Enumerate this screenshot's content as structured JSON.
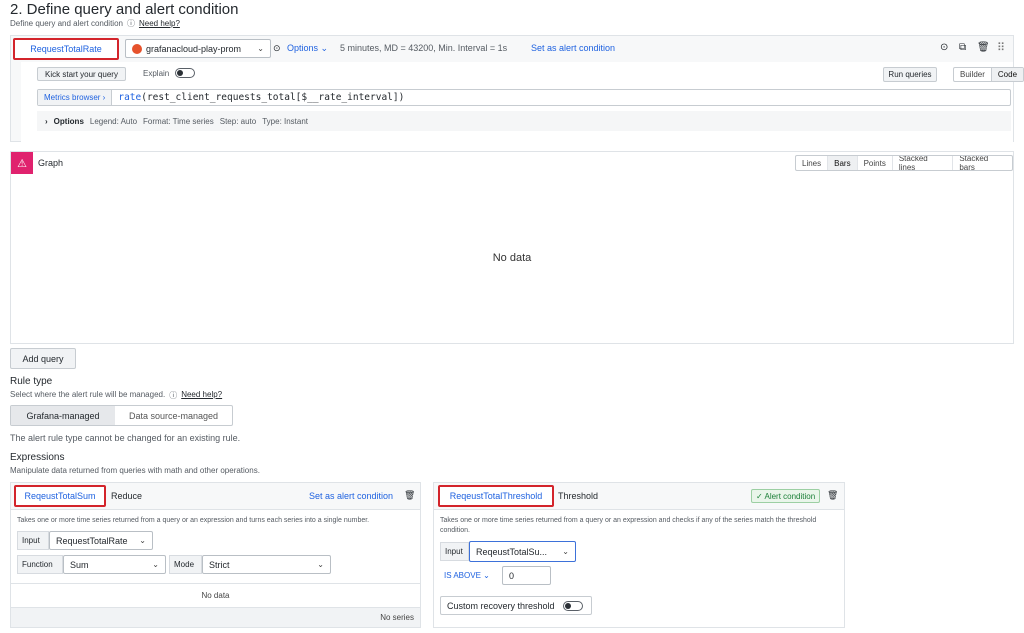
{
  "header": {
    "title": "2. Define query and alert condition",
    "subtitle": "Define query and alert condition",
    "help_link": "Need help?"
  },
  "query": {
    "name": "RequestTotalRate",
    "datasource": "grafanacloud-play-prom",
    "options_label": "Options",
    "options_summary": "5 minutes, MD = 43200, Min. Interval = 1s",
    "set_condition": "Set as alert condition",
    "kickstart": "Kick start your query",
    "explain": "Explain",
    "run_queries": "Run queries",
    "mode_builder": "Builder",
    "mode_code": "Code",
    "metrics_browser": "Metrics browser ›",
    "expr_fn": "rate",
    "expr_rest": "(rest_client_requests_total[$__rate_interval])",
    "options_row_label": "Options",
    "opt_legend": "Legend: Auto",
    "opt_format": "Format: Time series",
    "opt_step": "Step: auto",
    "opt_type": "Type: Instant"
  },
  "graph": {
    "title": "Graph",
    "modes": [
      "Lines",
      "Bars",
      "Points",
      "Stacked lines",
      "Stacked bars"
    ],
    "active_mode": "Bars",
    "no_data": "No data"
  },
  "add_query": "Add query",
  "rule_type": {
    "title": "Rule type",
    "subtitle": "Select where the alert rule will be managed.",
    "help_link": "Need help?",
    "option1": "Grafana-managed",
    "option2": "Data source-managed",
    "note": "The alert rule type cannot be changed for an existing rule."
  },
  "expressions": {
    "title": "Expressions",
    "subtitle": "Manipulate data returned from queries with math and other operations.",
    "reduce": {
      "name": "ReqeustTotalSum",
      "type": "Reduce",
      "set_condition": "Set as alert condition",
      "description": "Takes one or more time series returned from a query or an expression and turns each series into a single number.",
      "input_label": "Input",
      "input_value": "RequestTotalRate",
      "function_label": "Function",
      "function_value": "Sum",
      "mode_label": "Mode",
      "mode_value": "Strict",
      "no_data": "No data",
      "no_series": "No series"
    },
    "threshold": {
      "name": "ReqeustTotalThreshold",
      "type": "Threshold",
      "badge": "✓ Alert condition",
      "description": "Takes one or more time series returned from a query or an expression and checks if any of the series match the threshold condition.",
      "input_label": "Input",
      "input_value": "ReqeustTotalSu...",
      "op_label": "IS ABOVE",
      "threshold_value": "0",
      "recovery_label": "Custom recovery threshold"
    }
  },
  "colors": {
    "accent": "#1f62e0",
    "highlight": "#d3242b",
    "graph_icon": "#e0226e",
    "success": "#1a7f37"
  }
}
